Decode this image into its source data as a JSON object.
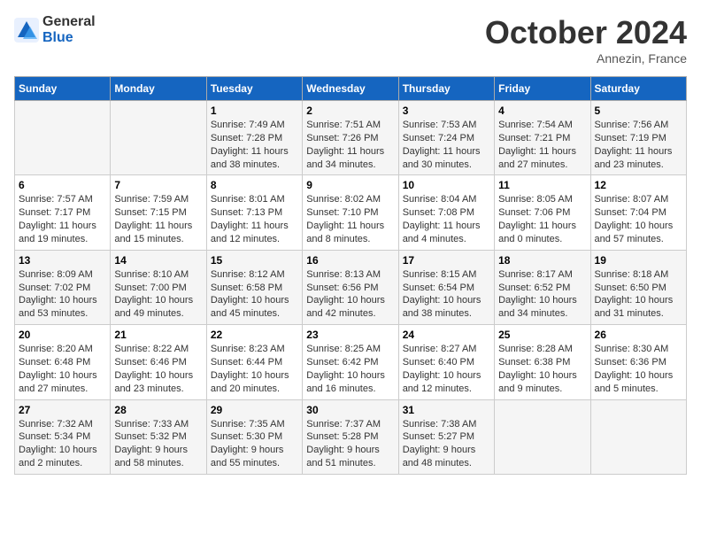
{
  "header": {
    "logo_general": "General",
    "logo_blue": "Blue",
    "month_year": "October 2024",
    "location": "Annezin, France"
  },
  "days_of_week": [
    "Sunday",
    "Monday",
    "Tuesday",
    "Wednesday",
    "Thursday",
    "Friday",
    "Saturday"
  ],
  "weeks": [
    [
      {
        "day": "",
        "info": ""
      },
      {
        "day": "",
        "info": ""
      },
      {
        "day": "1",
        "info": "Sunrise: 7:49 AM\nSunset: 7:28 PM\nDaylight: 11 hours\nand 38 minutes."
      },
      {
        "day": "2",
        "info": "Sunrise: 7:51 AM\nSunset: 7:26 PM\nDaylight: 11 hours\nand 34 minutes."
      },
      {
        "day": "3",
        "info": "Sunrise: 7:53 AM\nSunset: 7:24 PM\nDaylight: 11 hours\nand 30 minutes."
      },
      {
        "day": "4",
        "info": "Sunrise: 7:54 AM\nSunset: 7:21 PM\nDaylight: 11 hours\nand 27 minutes."
      },
      {
        "day": "5",
        "info": "Sunrise: 7:56 AM\nSunset: 7:19 PM\nDaylight: 11 hours\nand 23 minutes."
      }
    ],
    [
      {
        "day": "6",
        "info": "Sunrise: 7:57 AM\nSunset: 7:17 PM\nDaylight: 11 hours\nand 19 minutes."
      },
      {
        "day": "7",
        "info": "Sunrise: 7:59 AM\nSunset: 7:15 PM\nDaylight: 11 hours\nand 15 minutes."
      },
      {
        "day": "8",
        "info": "Sunrise: 8:01 AM\nSunset: 7:13 PM\nDaylight: 11 hours\nand 12 minutes."
      },
      {
        "day": "9",
        "info": "Sunrise: 8:02 AM\nSunset: 7:10 PM\nDaylight: 11 hours\nand 8 minutes."
      },
      {
        "day": "10",
        "info": "Sunrise: 8:04 AM\nSunset: 7:08 PM\nDaylight: 11 hours\nand 4 minutes."
      },
      {
        "day": "11",
        "info": "Sunrise: 8:05 AM\nSunset: 7:06 PM\nDaylight: 11 hours\nand 0 minutes."
      },
      {
        "day": "12",
        "info": "Sunrise: 8:07 AM\nSunset: 7:04 PM\nDaylight: 10 hours\nand 57 minutes."
      }
    ],
    [
      {
        "day": "13",
        "info": "Sunrise: 8:09 AM\nSunset: 7:02 PM\nDaylight: 10 hours\nand 53 minutes."
      },
      {
        "day": "14",
        "info": "Sunrise: 8:10 AM\nSunset: 7:00 PM\nDaylight: 10 hours\nand 49 minutes."
      },
      {
        "day": "15",
        "info": "Sunrise: 8:12 AM\nSunset: 6:58 PM\nDaylight: 10 hours\nand 45 minutes."
      },
      {
        "day": "16",
        "info": "Sunrise: 8:13 AM\nSunset: 6:56 PM\nDaylight: 10 hours\nand 42 minutes."
      },
      {
        "day": "17",
        "info": "Sunrise: 8:15 AM\nSunset: 6:54 PM\nDaylight: 10 hours\nand 38 minutes."
      },
      {
        "day": "18",
        "info": "Sunrise: 8:17 AM\nSunset: 6:52 PM\nDaylight: 10 hours\nand 34 minutes."
      },
      {
        "day": "19",
        "info": "Sunrise: 8:18 AM\nSunset: 6:50 PM\nDaylight: 10 hours\nand 31 minutes."
      }
    ],
    [
      {
        "day": "20",
        "info": "Sunrise: 8:20 AM\nSunset: 6:48 PM\nDaylight: 10 hours\nand 27 minutes."
      },
      {
        "day": "21",
        "info": "Sunrise: 8:22 AM\nSunset: 6:46 PM\nDaylight: 10 hours\nand 23 minutes."
      },
      {
        "day": "22",
        "info": "Sunrise: 8:23 AM\nSunset: 6:44 PM\nDaylight: 10 hours\nand 20 minutes."
      },
      {
        "day": "23",
        "info": "Sunrise: 8:25 AM\nSunset: 6:42 PM\nDaylight: 10 hours\nand 16 minutes."
      },
      {
        "day": "24",
        "info": "Sunrise: 8:27 AM\nSunset: 6:40 PM\nDaylight: 10 hours\nand 12 minutes."
      },
      {
        "day": "25",
        "info": "Sunrise: 8:28 AM\nSunset: 6:38 PM\nDaylight: 10 hours\nand 9 minutes."
      },
      {
        "day": "26",
        "info": "Sunrise: 8:30 AM\nSunset: 6:36 PM\nDaylight: 10 hours\nand 5 minutes."
      }
    ],
    [
      {
        "day": "27",
        "info": "Sunrise: 7:32 AM\nSunset: 5:34 PM\nDaylight: 10 hours\nand 2 minutes."
      },
      {
        "day": "28",
        "info": "Sunrise: 7:33 AM\nSunset: 5:32 PM\nDaylight: 9 hours\nand 58 minutes."
      },
      {
        "day": "29",
        "info": "Sunrise: 7:35 AM\nSunset: 5:30 PM\nDaylight: 9 hours\nand 55 minutes."
      },
      {
        "day": "30",
        "info": "Sunrise: 7:37 AM\nSunset: 5:28 PM\nDaylight: 9 hours\nand 51 minutes."
      },
      {
        "day": "31",
        "info": "Sunrise: 7:38 AM\nSunset: 5:27 PM\nDaylight: 9 hours\nand 48 minutes."
      },
      {
        "day": "",
        "info": ""
      },
      {
        "day": "",
        "info": ""
      }
    ]
  ]
}
